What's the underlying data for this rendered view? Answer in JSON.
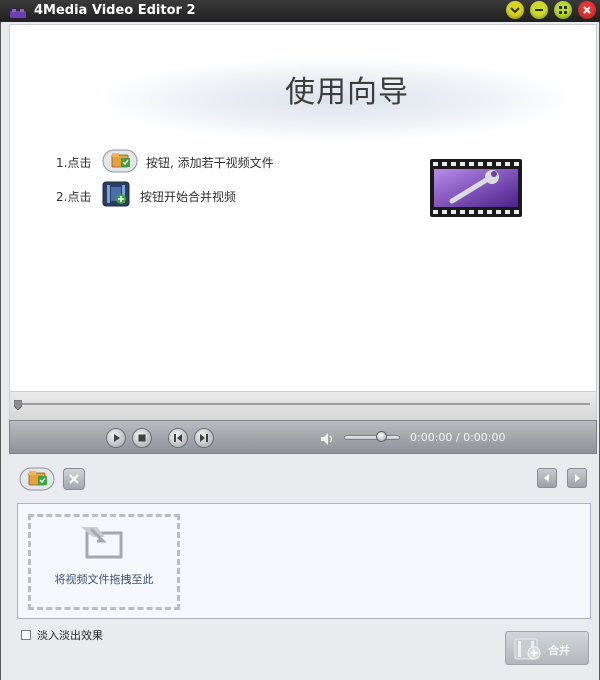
{
  "window": {
    "title": "4Media Video Editor 2",
    "icons": [
      "app-logo-icon",
      "help-icon",
      "minimize-icon",
      "maximize-icon",
      "close-icon"
    ],
    "colors": {
      "help": "#d8d51e",
      "minimize": "#cddc2a",
      "maximize": "#b9d832",
      "close": "#e53532"
    }
  },
  "wizard": {
    "title": "使用向导",
    "steps": [
      {
        "prefix": "1.点击",
        "icon": "add-file-icon",
        "text": "按钮, 添加若干视频文件"
      },
      {
        "prefix": "2.点击",
        "icon": "merge-video-icon",
        "text": "按钮开始合并视频"
      }
    ],
    "illustration_icon": "film-wrench-icon"
  },
  "player": {
    "progress": 0,
    "volume": 0.6,
    "time_current": "0:00:00",
    "time_total": "0:00:00",
    "time_display": "0:00:00 / 0:00:00",
    "icons": [
      "play-icon",
      "stop-icon",
      "previous-icon",
      "next-icon",
      "volume-icon"
    ]
  },
  "clips": {
    "toolbar_icons": [
      "add-file-icon",
      "remove-icon",
      "scroll-left-icon",
      "scroll-right-icon"
    ],
    "drop_text": "将视频文件拖拽至此",
    "drop_icon": "drag-drop-icon"
  },
  "options": {
    "fade_label": "淡入淡出效果",
    "fade_checked": false
  },
  "merge_button": {
    "label": "合并",
    "icon": "merge-video-icon",
    "enabled": false
  }
}
